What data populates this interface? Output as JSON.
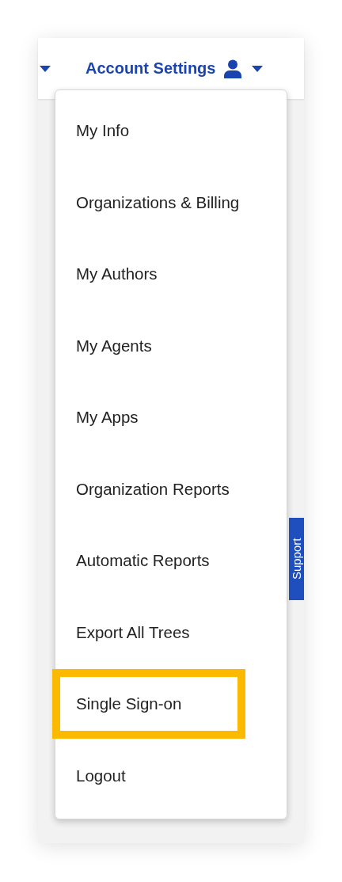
{
  "nav": {
    "title": "Account Settings"
  },
  "menu": {
    "items": [
      {
        "label": "My Info",
        "highlighted": false
      },
      {
        "label": "Organizations & Billing",
        "highlighted": false
      },
      {
        "label": "My Authors",
        "highlighted": false
      },
      {
        "label": "My Agents",
        "highlighted": false
      },
      {
        "label": "My Apps",
        "highlighted": false
      },
      {
        "label": "Organization Reports",
        "highlighted": false
      },
      {
        "label": "Automatic Reports",
        "highlighted": false
      },
      {
        "label": "Export All Trees",
        "highlighted": false
      },
      {
        "label": "Single Sign-on",
        "highlighted": true
      },
      {
        "label": "Logout",
        "highlighted": false
      }
    ]
  },
  "support_tab": {
    "label": "Support"
  }
}
